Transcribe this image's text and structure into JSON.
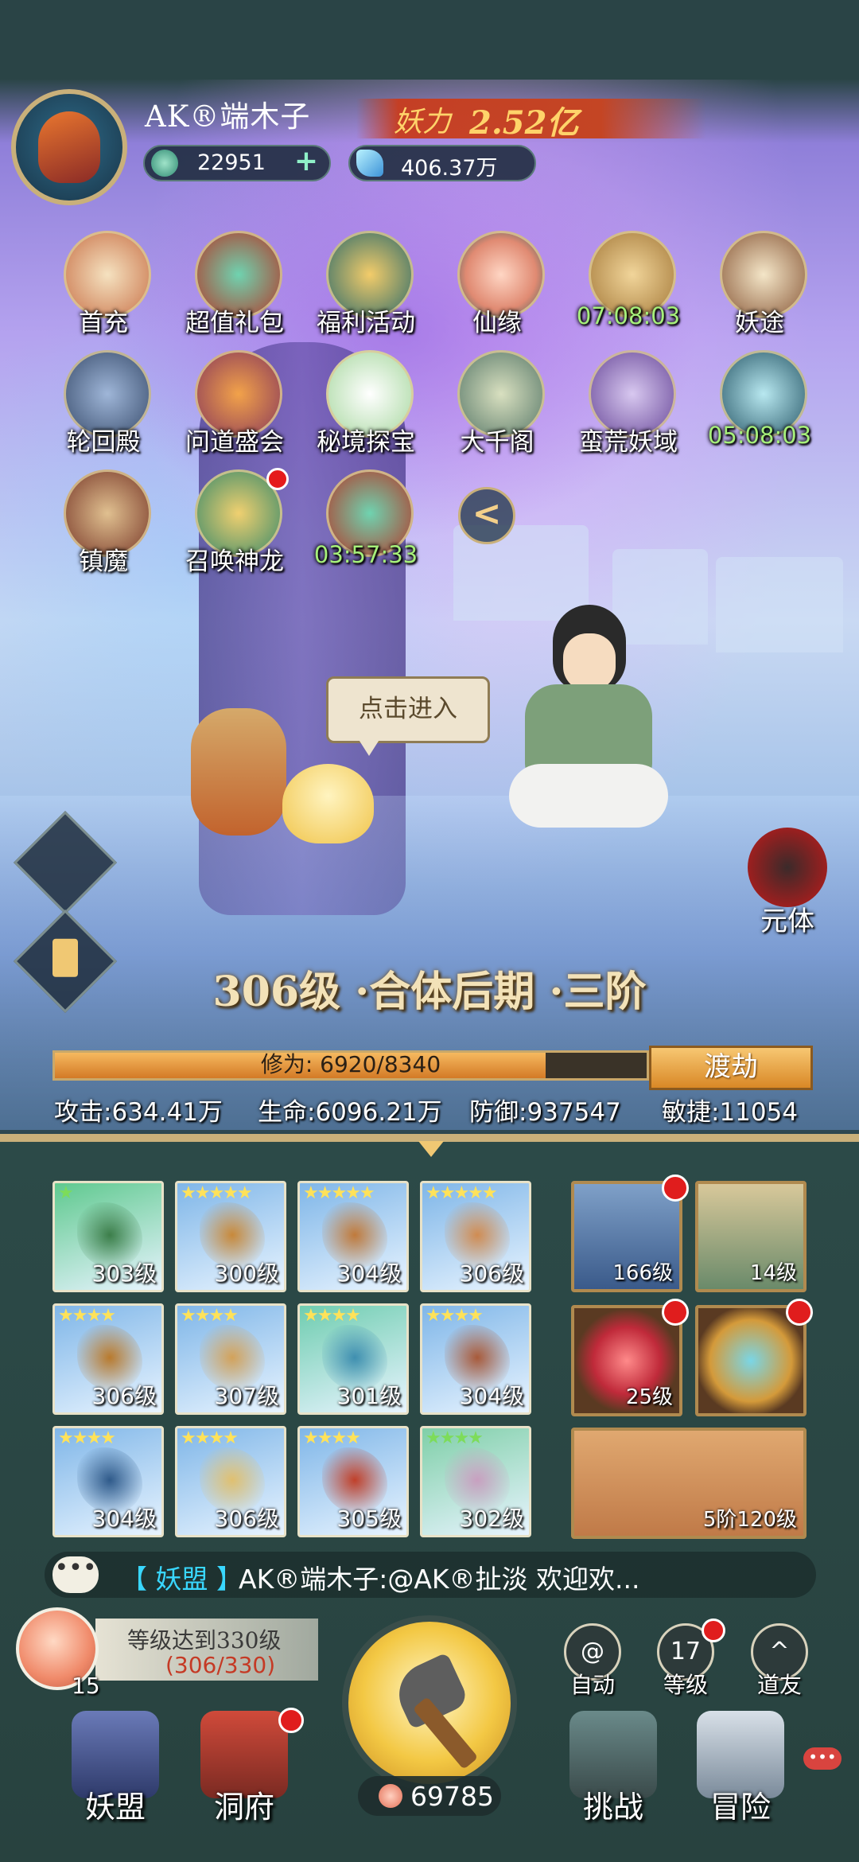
{
  "player": {
    "name": "AK®端木子",
    "power_label": "妖力",
    "power_value": "2.52亿",
    "currency_jade": "22951",
    "currency_crystal": "406.37万",
    "plus": "+"
  },
  "activities": [
    {
      "label": "首充",
      "timer": false,
      "dot": false
    },
    {
      "label": "超值礼包",
      "timer": false,
      "dot": false
    },
    {
      "label": "福利活动",
      "timer": false,
      "dot": false
    },
    {
      "label": "仙缘",
      "timer": false,
      "dot": false
    },
    {
      "label": "07:08:03",
      "timer": true,
      "dot": false
    },
    {
      "label": "妖途",
      "timer": false,
      "dot": false
    },
    {
      "label": "轮回殿",
      "timer": false,
      "dot": false
    },
    {
      "label": "问道盛会",
      "timer": false,
      "dot": false
    },
    {
      "label": "秘境探宝",
      "timer": false,
      "dot": false
    },
    {
      "label": "大千阁",
      "timer": false,
      "dot": false
    },
    {
      "label": "蛮荒妖域",
      "timer": false,
      "dot": false
    },
    {
      "label": "05:08:03",
      "timer": true,
      "dot": false
    },
    {
      "label": "镇魔",
      "timer": false,
      "dot": false
    },
    {
      "label": "召唤神龙",
      "timer": false,
      "dot": true
    },
    {
      "label": "03:57:33",
      "timer": true,
      "dot": false
    }
  ],
  "collapse_glyph": "<",
  "scene": {
    "bubble": "点击进入",
    "yuanti": "元体",
    "realm": "306级 ·合体后期 ·三阶"
  },
  "cultivation": {
    "label": "修为: 6920/8340",
    "current": 6920,
    "max": 8340,
    "breakthrough": "渡劫"
  },
  "stats": {
    "attack": "攻击:634.41万",
    "hp": "生命:6096.21万",
    "defense": "防御:937547",
    "agility": "敏捷:11054"
  },
  "cards": [
    {
      "stars": "★",
      "green": true,
      "level": "303级",
      "bg": "#5fc98f",
      "art": "#3c7e4a"
    },
    {
      "stars": "★★★★★",
      "green": false,
      "level": "300级",
      "bg": "#7fb6e8",
      "art": "#c8893a"
    },
    {
      "stars": "★★★★★",
      "green": false,
      "level": "304级",
      "bg": "#7fb6e8",
      "art": "#c07a3b"
    },
    {
      "stars": "★★★★★",
      "green": false,
      "level": "306级",
      "bg": "#7fb6e8",
      "art": "#d08c52"
    },
    {
      "stars": "★★★★",
      "green": false,
      "level": "306级",
      "bg": "#7fb6e8",
      "art": "#b97a2d"
    },
    {
      "stars": "★★★★",
      "green": false,
      "level": "307级",
      "bg": "#7fb6e8",
      "art": "#d3a25a"
    },
    {
      "stars": "★★★★",
      "green": false,
      "level": "301级",
      "bg": "#6fcdb0",
      "art": "#3f8fb0"
    },
    {
      "stars": "★★★★",
      "green": false,
      "level": "304级",
      "bg": "#7fb6e8",
      "art": "#a85a3a"
    },
    {
      "stars": "★★★★",
      "green": false,
      "level": "304级",
      "bg": "#7fb6e8",
      "art": "#2f5a8a"
    },
    {
      "stars": "★★★★",
      "green": false,
      "level": "306级",
      "bg": "#7fb6e8",
      "art": "#e0c070"
    },
    {
      "stars": "★★★★",
      "green": false,
      "level": "305级",
      "bg": "#7fb6e8",
      "art": "#c0402a"
    },
    {
      "stars": "★★★★",
      "green": true,
      "level": "302级",
      "bg": "#7fcfa8",
      "art": "#c8a0c0"
    }
  ],
  "right_items": {
    "dragon_level": "166级",
    "otter_level": "14级",
    "orb_level": "25级",
    "gourd_level": "5阶120级"
  },
  "chat": {
    "icon": "•••",
    "channel": "【 妖盟 】",
    "message": "AK®端木子:@AK®扯淡 欢迎欢..."
  },
  "quest": {
    "count": "15",
    "title": "等级达到330级",
    "progress": "(306/330)"
  },
  "peach_count": "69785",
  "right_buttons": {
    "auto": "自动",
    "level_num": "17",
    "level": "等级",
    "friends": "道友"
  },
  "nav": {
    "alliance": "妖盟",
    "cave": "洞府",
    "challenge": "挑战",
    "adventure": "冒险"
  },
  "corner_badge": "•••"
}
